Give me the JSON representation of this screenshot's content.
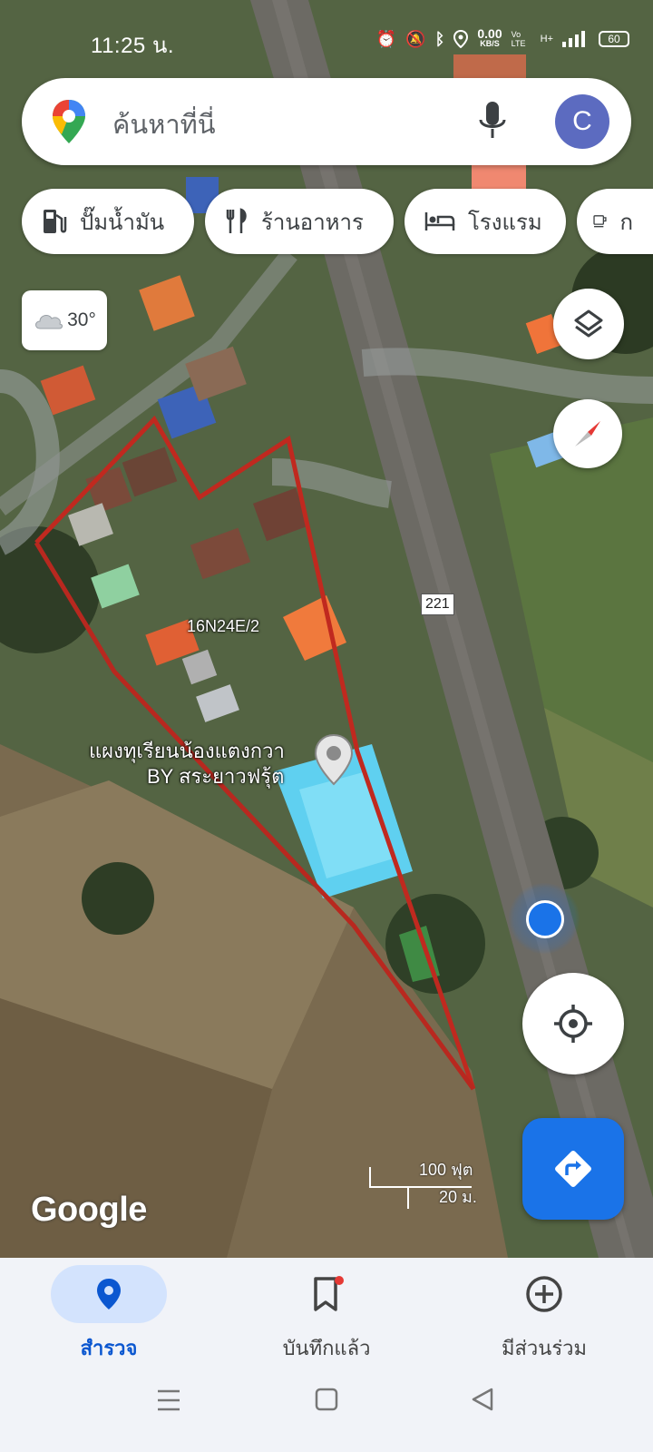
{
  "status_bar": {
    "time": "11:25 น.",
    "net_speed_value": "0.00",
    "net_speed_unit": "KB/S",
    "volte": "Vo LTE",
    "net_type": "H+",
    "battery": "60",
    "icons": [
      "alarm-icon",
      "bell-off-icon",
      "bluetooth-icon",
      "location-icon",
      "signal-icon"
    ]
  },
  "search": {
    "placeholder": "ค้นหาที่นี่",
    "avatar_letter": "C"
  },
  "chips": [
    {
      "label": "ปั๊มน้ำมัน",
      "icon": "gas-station-icon"
    },
    {
      "label": "ร้านอาหาร",
      "icon": "restaurant-icon"
    },
    {
      "label": "โรงแรม",
      "icon": "hotel-icon"
    },
    {
      "label": "ก",
      "icon": "coffee-icon"
    }
  ],
  "weather": {
    "temp": "30°",
    "icon": "cloud-icon"
  },
  "map": {
    "road_label": "221",
    "plus_code": "16N24E/2",
    "place_line1": "แผงทุเรียนน้องแตงกวา",
    "place_line2": "BY สระยาวฟรุ้ต",
    "attribution": "Google",
    "scale_ft": "100 ฟุต",
    "scale_m": "20 ม.",
    "accent_color": "#1a73e8",
    "drawn_outline_color": "#c0291f"
  },
  "bottom_nav": [
    {
      "label": "สำรวจ",
      "icon": "explore-pin-icon",
      "active": true
    },
    {
      "label": "บันทึกแล้ว",
      "icon": "bookmark-icon",
      "active": false
    },
    {
      "label": "มีส่วนร่วม",
      "icon": "add-circle-icon",
      "active": false
    }
  ],
  "system_nav": [
    "menu-icon",
    "home-icon",
    "back-icon"
  ]
}
